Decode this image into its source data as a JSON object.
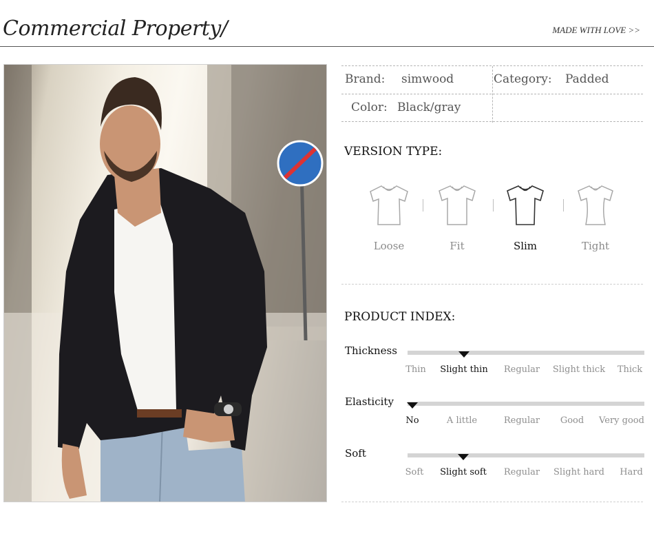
{
  "header": {
    "title": "Commercial Property/",
    "tagline": "MADE WITH LOVE >>"
  },
  "specs": {
    "brand_label": "Brand:",
    "brand_value": "simwood",
    "category_label": "Category:",
    "category_value": "Padded",
    "color_label": "Color:",
    "color_value": "Black/gray"
  },
  "version_type": {
    "title": "VERSION TYPE:",
    "options": [
      "Loose",
      "Fit",
      "Slim",
      "Tight"
    ],
    "selected": "Slim"
  },
  "product_index": {
    "title": "PRODUCT INDEX:",
    "rows": [
      {
        "label": "Thickness",
        "ticks": [
          "Thin",
          "Slight thin",
          "Regular",
          "Slight thick",
          "Thick"
        ],
        "selected_index": 1
      },
      {
        "label": "Elasticity",
        "ticks": [
          "No",
          "A little",
          "Regular",
          "Good",
          "Very good"
        ],
        "selected_index": 0
      },
      {
        "label": "Soft",
        "ticks": [
          "Soft",
          "Slight soft",
          "Regular",
          "Slight hard",
          "Hard"
        ],
        "selected_index": 1
      }
    ]
  },
  "colors": {
    "accent": "#111111",
    "muted": "#8e8e8e",
    "track": "#d4d4d4",
    "jacket": "#1c1b1f",
    "shirt": "#f6f5f2",
    "jeans": "#9fb3c8"
  }
}
